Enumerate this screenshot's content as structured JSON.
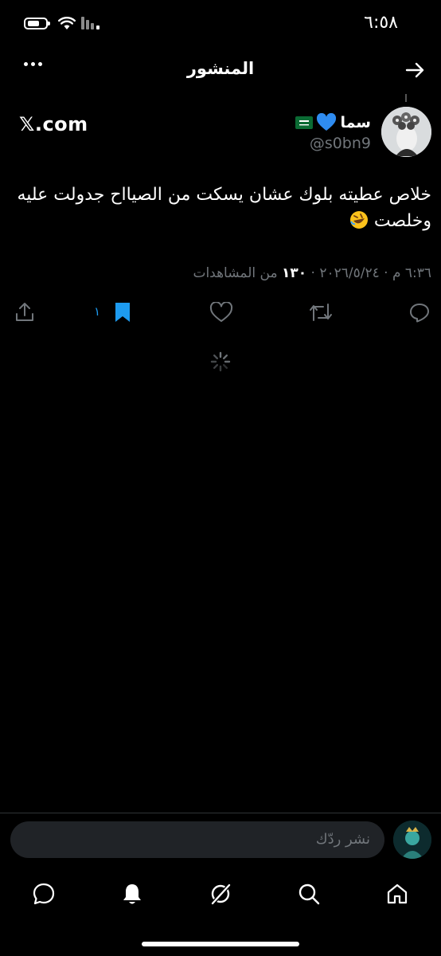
{
  "status_bar": {
    "time": "٦:٥٨",
    "icons": [
      "battery-icon",
      "wifi-icon",
      "cellular-signal-icon"
    ]
  },
  "header": {
    "title": "المنشور",
    "back_icon": "arrow-right-icon",
    "more_icon": "more-horizontal-icon"
  },
  "post": {
    "display_name": "سما",
    "badges": [
      "blue-heart-emoji",
      "saudi-flag-emoji"
    ],
    "handle": "@s0bn9",
    "source_label": "𝕏.com",
    "text": "خلاص عطيته بلوك عشان يسكت من الصيااح جدولت عليه وخلصت",
    "text_emoji": "rolling-on-the-floor-laughing-emoji",
    "datetime": "٦:٣٦ م · ٢٠٢٦/٥/٢٤ · ",
    "views_count": "١٣٠",
    "views_label": "من المشاهدات",
    "actions": {
      "bookmark_count": "١"
    }
  },
  "reply": {
    "placeholder": "نشر ردّك"
  },
  "bottom_nav": {
    "items": [
      "home-icon",
      "search-icon",
      "grok-icon",
      "notifications-icon",
      "messages-icon"
    ]
  },
  "colors": {
    "background": "#000000",
    "text": "#e7e9ea",
    "muted": "#71767b",
    "accent": "#1d9bf0"
  }
}
